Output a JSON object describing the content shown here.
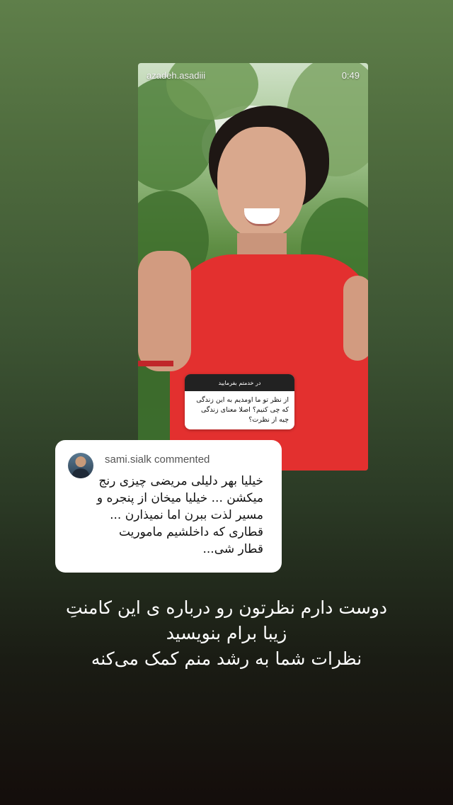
{
  "story": {
    "username": "azadeh.asadiii",
    "time": "0:49",
    "question_header": "در خدمتم بفرمایید",
    "question_text": "از نظر تو ما اومدیم به این زندگی که چی کنیم؟ اصلا معنای زندگی چیه از نظرت؟"
  },
  "comment": {
    "author_line": "sami.sialk commented",
    "text": "خیلیا بهر دلیلی مریضی چیزی رنج میکشن ... خیلیا میخان از پنجره و مسیر لذت ببرن اما نمیذارن ... قطاری که داخلشیم ماموریت قطار شی..."
  },
  "caption": {
    "line1": "دوست دارم نظرتون رو درباره ی این کامنتِ",
    "line2": "زیبا برام بنویسید",
    "line3": "نظرات شما به رشد منم کمک می‌کنه"
  },
  "colors": {
    "background_top": "#5f7f4a",
    "background_bottom": "#140d0b",
    "shirt": "#e3302f",
    "card": "#ffffff"
  }
}
